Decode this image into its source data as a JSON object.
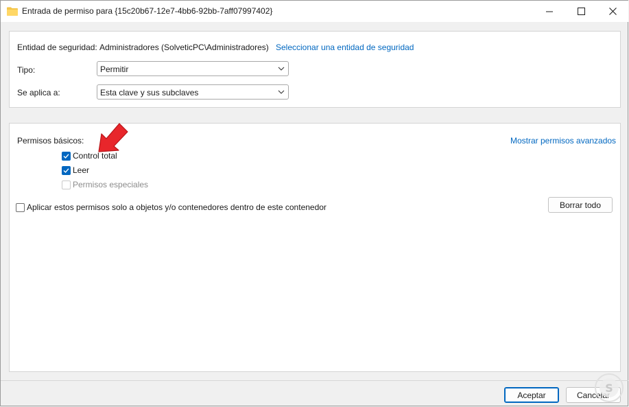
{
  "window": {
    "title": "Entrada de permiso para {15c20b67-12e7-4bb6-92bb-7aff07997402}"
  },
  "principal": {
    "label": "Entidad de seguridad:",
    "value": "Administradores (SolveticPC\\Administradores)",
    "select_link": "Seleccionar una entidad de seguridad"
  },
  "type": {
    "label": "Tipo:",
    "value": "Permitir"
  },
  "applies_to": {
    "label": "Se aplica a:",
    "value": "Esta clave y sus subclaves"
  },
  "permissions": {
    "heading": "Permisos básicos:",
    "advanced_link": "Mostrar permisos avanzados",
    "items": [
      {
        "label": "Control total",
        "checked": true,
        "enabled": true
      },
      {
        "label": "Leer",
        "checked": true,
        "enabled": true
      },
      {
        "label": "Permisos especiales",
        "checked": false,
        "enabled": false
      }
    ],
    "apply_only_label": "Aplicar estos permisos solo a objetos y/o contenedores dentro de este contenedor",
    "clear_all": "Borrar todo"
  },
  "footer": {
    "ok": "Aceptar",
    "cancel": "Cancelar"
  },
  "colors": {
    "accent": "#0067c0",
    "annotation_arrow": "#e8262b"
  }
}
